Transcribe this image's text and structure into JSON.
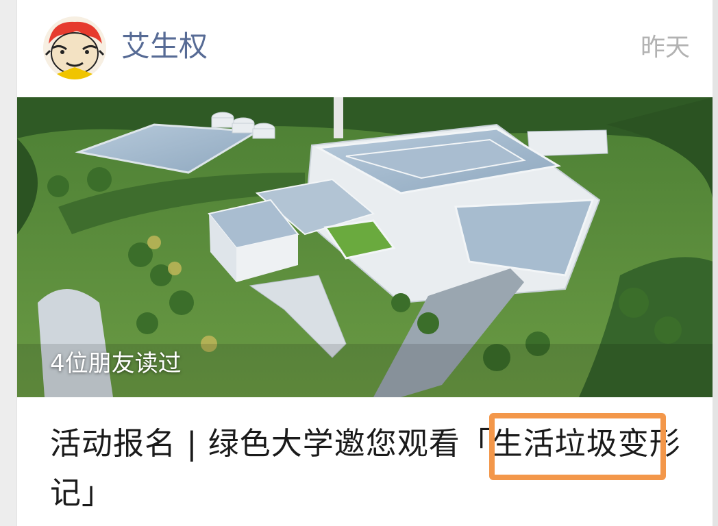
{
  "post": {
    "author": "艾生权",
    "time": "昨天",
    "friends_read": "4位朋友读过",
    "title": "活动报名 | 绿色大学邀您观看「生活垃圾变形记」"
  },
  "cover": {
    "description_icon": "cover-image",
    "colors": {
      "grass": "#5f8f3e",
      "forest": "#2f5a25",
      "roof": "#9eb6cc",
      "wall": "#e9edf0"
    }
  },
  "annotation": {
    "highlight_color": "#f3974a"
  },
  "colors": {
    "author": "#576b95",
    "time": "#b2b2b2",
    "title": "#1a1a1a"
  }
}
